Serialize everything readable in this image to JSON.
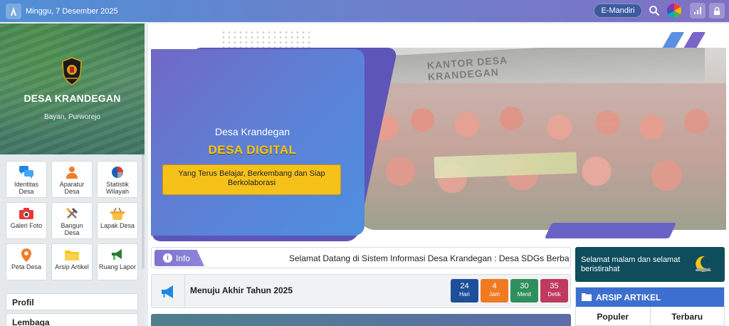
{
  "topbar": {
    "date": "Minggu, 7 Desember 2025",
    "emandiri_label": "E-Mandiri",
    "icons": [
      "logo-icon",
      "search-icon",
      "color-wheel-icon",
      "signal-icon",
      "lock-icon"
    ]
  },
  "village": {
    "name": "DESA KRANDEGAN",
    "location": "Bayan, Purworejo"
  },
  "menu_tiles": [
    {
      "label": "Identitas Desa",
      "icon": "chat-bubbles-icon",
      "color": "#1e88e5"
    },
    {
      "label": "Aparatur Desa",
      "icon": "person-icon",
      "color": "#ef7d2a"
    },
    {
      "label": "Statistik Wilayah",
      "icon": "pie-chart-icon",
      "color": "#e53935"
    },
    {
      "label": "Galeri Foto",
      "icon": "camera-icon",
      "color": "#e53935"
    },
    {
      "label": "Bangun Desa",
      "icon": "tools-icon",
      "color": "#555555"
    },
    {
      "label": "Lapak Desa",
      "icon": "basket-icon",
      "color": "#f5a623"
    },
    {
      "label": "Peta Desa",
      "icon": "map-pin-icon",
      "color": "#ef7d2a"
    },
    {
      "label": "Arsip Artikel",
      "icon": "folder-icon",
      "color": "#f5c518"
    },
    {
      "label": "Ruang Lapor",
      "icon": "megaphone-icon",
      "color": "#2e7d32"
    }
  ],
  "side_links": [
    "Profil",
    "Lembaga"
  ],
  "banner": {
    "line1": "Desa Krandegan",
    "line2": "DESA DIGITAL",
    "tagline": "Yang Terus Belajar, Berkembang dan Siap Berkolaborasi",
    "photo_sign": "KANTOR DESA KRANDEGAN"
  },
  "info": {
    "label": "Info",
    "ticker": "Selamat Datang di Sistem Informasi Desa Krandegan : Desa SDGs Berba"
  },
  "countdown": {
    "title": "Menuju Akhir Tahun 2025",
    "units": [
      {
        "value": "24",
        "unit": "Hari",
        "color": "#1f4f9a"
      },
      {
        "value": "4",
        "unit": "Jam",
        "color": "#f07a22"
      },
      {
        "value": "30",
        "unit": "Menit",
        "color": "#2f8f5c"
      },
      {
        "value": "35",
        "unit": "Detik",
        "color": "#c0395f"
      }
    ]
  },
  "greeting": {
    "text": "Selamat malam dan selamat beristirahat"
  },
  "arsip": {
    "title": "ARSIP ARTIKEL",
    "tabs": [
      "Populer",
      "Terbaru"
    ]
  }
}
